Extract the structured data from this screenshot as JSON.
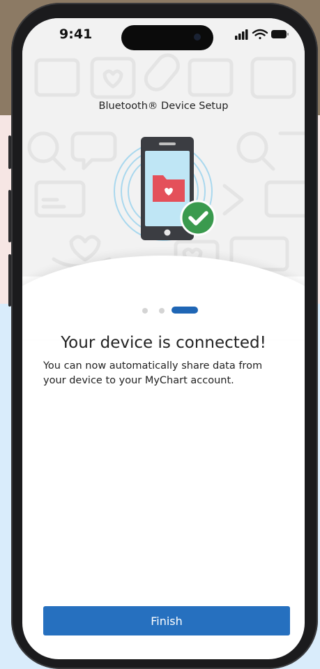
{
  "status_bar": {
    "time": "9:41"
  },
  "screen": {
    "title": "Bluetooth® Device Setup",
    "heading": "Your device is connected!",
    "description": "You can now automatically share data from your device to your MyChart account."
  },
  "pager": {
    "total": 3,
    "current": 3
  },
  "buttons": {
    "finish_label": "Finish"
  },
  "colors": {
    "accent": "#2670bf",
    "success": "#3a9a4e",
    "folder": "#e4505a",
    "phone_screen": "#bfe6f5"
  },
  "icons": [
    "cellular-signal-icon",
    "wifi-icon",
    "battery-icon",
    "phone-connected-illustration",
    "folder-heart-icon",
    "checkmark-icon"
  ]
}
